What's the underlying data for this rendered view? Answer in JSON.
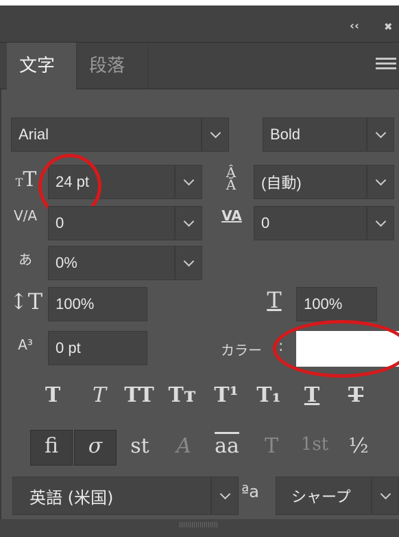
{
  "panel": {
    "collapse_glyph": "‹‹",
    "close_glyph": "✖"
  },
  "tabs": [
    {
      "label": "文字"
    },
    {
      "label": "段落"
    }
  ],
  "font": {
    "family": "Arial",
    "style": "Bold"
  },
  "metrics": {
    "size": "24 pt",
    "leading": "(自動)",
    "kerning": "0",
    "tracking": "0",
    "tsume": "0%",
    "vertical_scale": "100%",
    "horizontal_scale": "100%",
    "baseline_shift": "0 pt"
  },
  "color": {
    "label": "カラー",
    "colon": ":",
    "swatch": "#ffffff"
  },
  "type_styles": [
    "T",
    "T",
    "TT",
    "Tт",
    "T¹",
    "T₁",
    "T",
    "T"
  ],
  "opentype": [
    "fi",
    "σ",
    "st",
    "A",
    "aa",
    "T",
    "1st",
    "½"
  ],
  "language": {
    "value": "英語 (米国)",
    "aa_label": "ªa",
    "antialias": "シャープ"
  },
  "accent_colors": {
    "highlight": "#d6191b"
  }
}
